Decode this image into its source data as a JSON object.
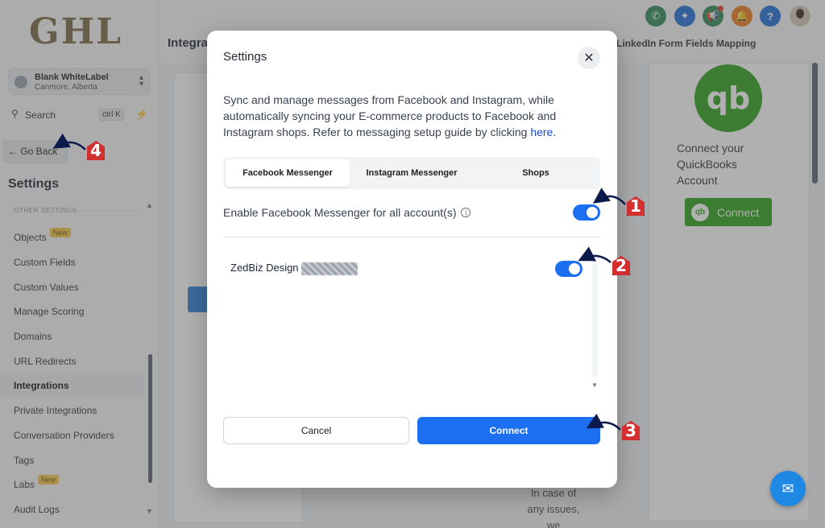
{
  "app": {
    "logo": "GHL",
    "account": {
      "name": "Blank WhiteLabel",
      "location": "Canmore, Alberta"
    },
    "search": {
      "label": "Search",
      "shortcut": "ctrl K"
    },
    "go_back": "Go Back",
    "settings_heading": "Settings",
    "section_label": "OTHER SETTINGS",
    "nav": [
      {
        "label": "Objects",
        "badge": "New"
      },
      {
        "label": "Custom Fields"
      },
      {
        "label": "Custom Values"
      },
      {
        "label": "Manage Scoring"
      },
      {
        "label": "Domains"
      },
      {
        "label": "URL Redirects"
      },
      {
        "label": "Integrations",
        "active": true
      },
      {
        "label": "Private Integrations"
      },
      {
        "label": "Conversation Providers"
      },
      {
        "label": "Tags"
      },
      {
        "label": "Labs",
        "badge": "New"
      },
      {
        "label": "Audit Logs"
      }
    ],
    "page_title": "Integra",
    "linkedin_mapping": "LinkedIn Form Fields Mapping",
    "quickbooks": {
      "text": "Connect your QuickBooks Account",
      "connect": "Connect"
    },
    "issues_text": "In case of any issues, we",
    "colors": {
      "accent": "#1d6ff2",
      "quickbooks": "#2ca01c",
      "marker": "#d32f2f"
    }
  },
  "modal": {
    "title": "Settings",
    "description": "Sync and manage messages from Facebook and Instagram, while automatically syncing your E-commerce products to Facebook and Instagram shops. Refer to messaging setup guide by clicking",
    "link_text": "here",
    "tabs": [
      "Facebook Messenger",
      "Instagram Messenger",
      "Shops"
    ],
    "enable_all": {
      "label": "Enable Facebook Messenger for all account(s)",
      "on": true
    },
    "accounts": [
      {
        "name": "ZedBiz Design",
        "on": true
      }
    ],
    "cancel": "Cancel",
    "connect": "Connect"
  },
  "annotations": [
    "1",
    "2",
    "3",
    "4"
  ]
}
